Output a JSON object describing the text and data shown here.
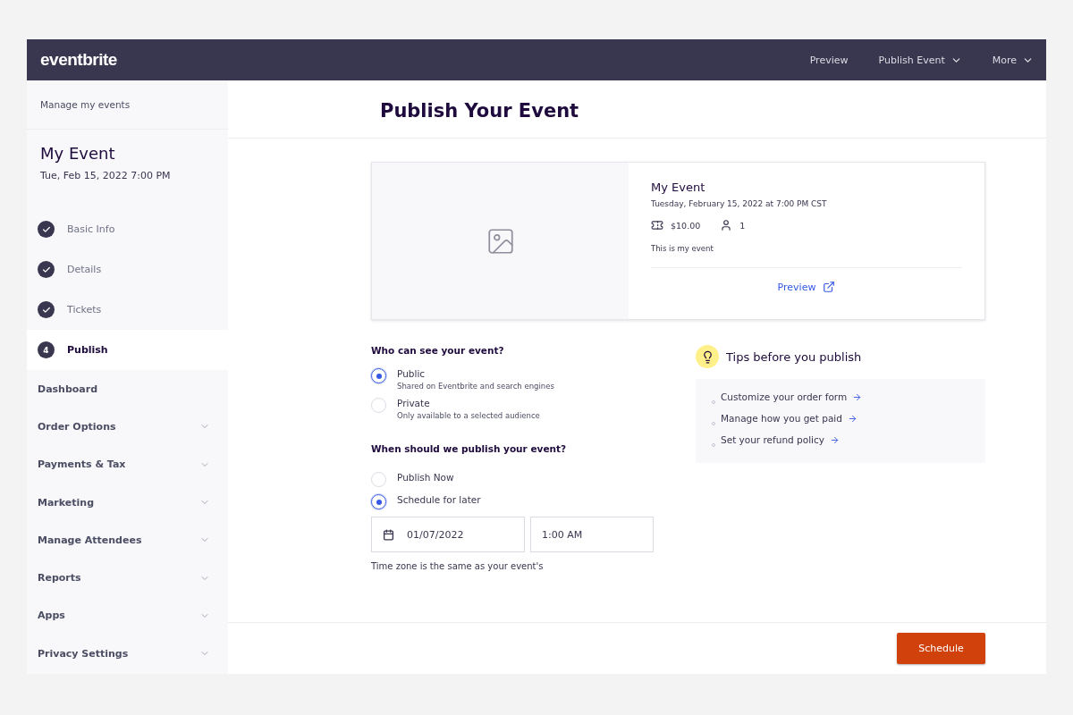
{
  "header": {
    "logo": "eventbrite",
    "nav": [
      {
        "label": "Preview",
        "dropdown": false
      },
      {
        "label": "Publish Event",
        "dropdown": true
      },
      {
        "label": "More",
        "dropdown": true
      }
    ]
  },
  "sidebar": {
    "back_link": "Manage my events",
    "event_title": "My Event",
    "event_date": "Tue, Feb 15, 2022 7:00 PM",
    "steps": [
      {
        "label": "Basic Info",
        "done": true,
        "selected": false
      },
      {
        "label": "Details",
        "done": true,
        "selected": false
      },
      {
        "label": "Tickets",
        "done": true,
        "selected": false
      },
      {
        "label": "Publish",
        "number": "4",
        "done": false,
        "selected": true
      }
    ],
    "menu": [
      {
        "label": "Dashboard",
        "has_submenu": false
      },
      {
        "label": "Order Options",
        "has_submenu": true
      },
      {
        "label": "Payments & Tax",
        "has_submenu": true
      },
      {
        "label": "Marketing",
        "has_submenu": true
      },
      {
        "label": "Manage Attendees",
        "has_submenu": true
      },
      {
        "label": "Reports",
        "has_submenu": true
      },
      {
        "label": "Apps",
        "has_submenu": true
      },
      {
        "label": "Privacy Settings",
        "has_submenu": true
      }
    ]
  },
  "page_title": "Publish Your Event",
  "event_card": {
    "title": "My Event",
    "datetime": "Tuesday, February 15, 2022 at 7:00 PM CST",
    "price": "$10.00",
    "capacity": "1",
    "description": "This is my event",
    "preview_link": "Preview"
  },
  "visibility": {
    "question": "Who can see your event?",
    "options": [
      {
        "label": "Public",
        "description": "Shared on Eventbrite and search engines",
        "selected": true
      },
      {
        "label": "Private",
        "description": "Only available to a selected audience",
        "selected": false
      }
    ]
  },
  "publish_time": {
    "question": "When should we publish your event?",
    "options": [
      {
        "label": "Publish Now",
        "selected": false
      },
      {
        "label": "Schedule for later",
        "selected": true
      }
    ],
    "date": "01/07/2022",
    "time": "1:00 AM",
    "note": "Time zone is the same as your event's"
  },
  "tips": {
    "title": "Tips before you publish",
    "items": [
      "Customize your order form",
      "Manage how you get paid",
      "Set your refund policy"
    ]
  },
  "footer": {
    "button": "Schedule"
  }
}
